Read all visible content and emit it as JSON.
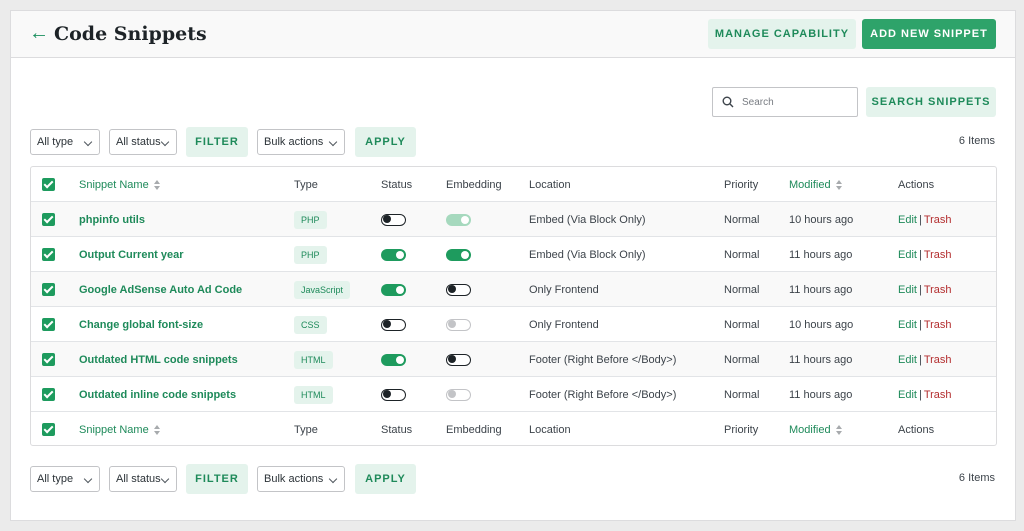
{
  "header": {
    "back_icon": "arrow-left-icon",
    "title": "Code Snippets",
    "manage_capability": "MANAGE CAPABILITY",
    "add_new": "ADD NEW SNIPPET"
  },
  "search": {
    "placeholder": "Search",
    "button": "SEARCH SNIPPETS"
  },
  "filters": {
    "type": "All type",
    "status": "All status",
    "filter_button": "FILTER",
    "bulk": "Bulk actions",
    "apply_button": "APPLY",
    "count": "6 Items"
  },
  "columns": {
    "name": "Snippet Name",
    "type": "Type",
    "status": "Status",
    "embedding": "Embedding",
    "location": "Location",
    "priority": "Priority",
    "modified": "Modified",
    "actions": "Actions"
  },
  "row_actions": {
    "edit": "Edit",
    "sep": "|",
    "trash": "Trash"
  },
  "rows": [
    {
      "name": "phpinfo utils",
      "type": "PHP",
      "status": "off",
      "embedding": "disabled-on",
      "location": "Embed (Via Block Only)",
      "priority": "Normal",
      "modified": "10 hours ago"
    },
    {
      "name": "Output Current year",
      "type": "PHP",
      "status": "on",
      "embedding": "on",
      "location": "Embed (Via Block Only)",
      "priority": "Normal",
      "modified": "11 hours ago"
    },
    {
      "name": "Google AdSense Auto Ad Code",
      "type": "JavaScript",
      "status": "on",
      "embedding": "off",
      "location": "Only Frontend",
      "priority": "Normal",
      "modified": "11 hours ago"
    },
    {
      "name": "Change global font-size",
      "type": "CSS",
      "status": "off",
      "embedding": "disabled-off",
      "location": "Only Frontend",
      "priority": "Normal",
      "modified": "10 hours ago"
    },
    {
      "name": "Outdated HTML code snippets",
      "type": "HTML",
      "status": "on",
      "embedding": "off",
      "location": "Footer (Right Before </Body>)",
      "priority": "Normal",
      "modified": "11 hours ago"
    },
    {
      "name": "Outdated inline code snippets",
      "type": "HTML",
      "status": "off",
      "embedding": "disabled-off",
      "location": "Footer (Right Before </Body>)",
      "priority": "Normal",
      "modified": "11 hours ago"
    }
  ],
  "colors": {
    "accent": "#1e9b5e",
    "accent_light": "#e4f3ec",
    "danger": "#b32d2e"
  }
}
